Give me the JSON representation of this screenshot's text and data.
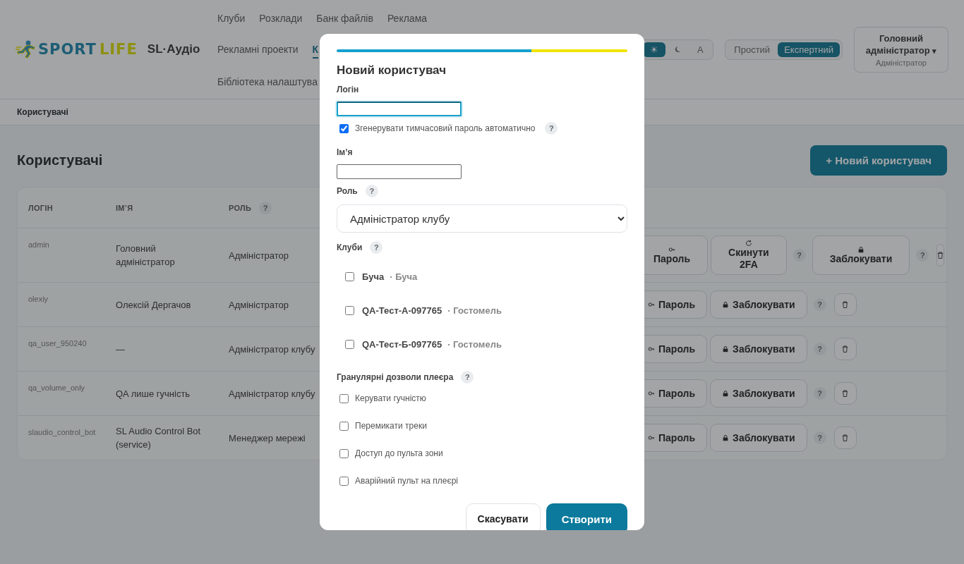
{
  "header": {
    "logo": {
      "word1": "SPORT",
      "word2": "LIFE"
    },
    "app_name": "SL·Аудіо",
    "nav": [
      {
        "label": "Клуби",
        "selected": false
      },
      {
        "label": "Розклади",
        "selected": false
      },
      {
        "label": "Банк файлів",
        "selected": false
      },
      {
        "label": "Реклама",
        "selected": false
      },
      {
        "label": "Рекламні проекти",
        "selected": false
      },
      {
        "label": "К",
        "selected": true
      },
      {
        "label": "Бібліотека налаштува",
        "selected": false
      }
    ],
    "theme_options": [
      {
        "kind": "sun",
        "label": "☀",
        "selected": true
      },
      {
        "kind": "moon",
        "selected": false
      },
      {
        "kind": "text",
        "label": "A",
        "selected": false
      }
    ],
    "mode_options": [
      {
        "label": "Простий",
        "selected": false
      },
      {
        "label": "Експертний",
        "selected": true
      }
    ],
    "user": {
      "name": "Головний адміністратор",
      "caret": "▾",
      "role": "Адміністратор"
    }
  },
  "breadcrumb": "Користувачі",
  "page": {
    "title": "Користувачі",
    "new_button": "+ Новий користувач"
  },
  "table": {
    "columns": [
      {
        "label": "ЛОГІН"
      },
      {
        "label": "ІМʼЯ"
      },
      {
        "label": "РОЛЬ",
        "help": "?"
      }
    ],
    "rows": [
      {
        "login": "admin",
        "name": "Головний адміністратор",
        "role": "Адміністратор",
        "actions": [
          {
            "kind": "password",
            "label": "Пароль"
          },
          {
            "kind": "reset",
            "label": "Скинути 2FA"
          },
          {
            "kind": "help",
            "label": "?"
          },
          {
            "kind": "block",
            "label": "Заблокувати"
          },
          {
            "kind": "help",
            "label": "?"
          },
          {
            "kind": "delete"
          }
        ]
      },
      {
        "login": "olexiy",
        "name": "Олексій Дергачов",
        "role": "Адміністратор",
        "actions": [
          {
            "kind": "password",
            "label": "Пароль"
          },
          {
            "kind": "block",
            "label": "Заблокувати"
          },
          {
            "kind": "help",
            "label": "?"
          },
          {
            "kind": "delete"
          }
        ]
      },
      {
        "login": "qa_user_950240",
        "name": "—",
        "role": "Адміністратор клубу",
        "actions": [
          {
            "kind": "password",
            "label": "Пароль"
          },
          {
            "kind": "block",
            "label": "Заблокувати"
          },
          {
            "kind": "help",
            "label": "?"
          },
          {
            "kind": "delete"
          }
        ]
      },
      {
        "login": "qa_volume_only",
        "name": "QA лише гучність",
        "role": "Адміністратор клубу",
        "actions": [
          {
            "kind": "password",
            "label": "Пароль"
          },
          {
            "kind": "block",
            "label": "Заблокувати"
          },
          {
            "kind": "help",
            "label": "?"
          },
          {
            "kind": "delete"
          }
        ]
      },
      {
        "login": "slaudio_control_bot",
        "name": "SL Audio Control Bot (service)",
        "role": "Менеджер мережі",
        "actions": [
          {
            "kind": "password",
            "label": "Пароль"
          },
          {
            "kind": "block",
            "label": "Заблокувати"
          },
          {
            "kind": "help",
            "label": "?"
          },
          {
            "kind": "delete"
          }
        ]
      }
    ]
  },
  "modal": {
    "title": "Новий користувач",
    "login": {
      "label": "Логін",
      "focused": true
    },
    "auto_password": {
      "label": "Згенерувати тимчасовий пароль автоматично",
      "checked": true,
      "help": "?"
    },
    "name": {
      "label": "Імʼя"
    },
    "role": {
      "label": "Роль",
      "help": "?",
      "value": "Адміністратор клубу"
    },
    "clubs": {
      "label": "Клуби",
      "help": "?",
      "items": [
        {
          "name": "Буча",
          "city": "· Буча",
          "checked": false
        },
        {
          "name": "QA-Тест-А-097765",
          "city": "· Гостомель",
          "checked": false
        },
        {
          "name": "QA-Тест-Б-097765",
          "city": "· Гостомель",
          "checked": false
        }
      ]
    },
    "permissions": {
      "label": "Гранулярні дозволи плеєра",
      "help": "?",
      "items": [
        {
          "label": "Керувати гучністю",
          "checked": false
        },
        {
          "label": "Перемикати треки",
          "checked": false
        },
        {
          "label": "Доступ до пульта зони",
          "checked": false
        },
        {
          "label": "Аварійний пульт на плеєрі",
          "checked": false
        }
      ]
    },
    "cancel": "Скасувати",
    "submit": "Створити"
  }
}
